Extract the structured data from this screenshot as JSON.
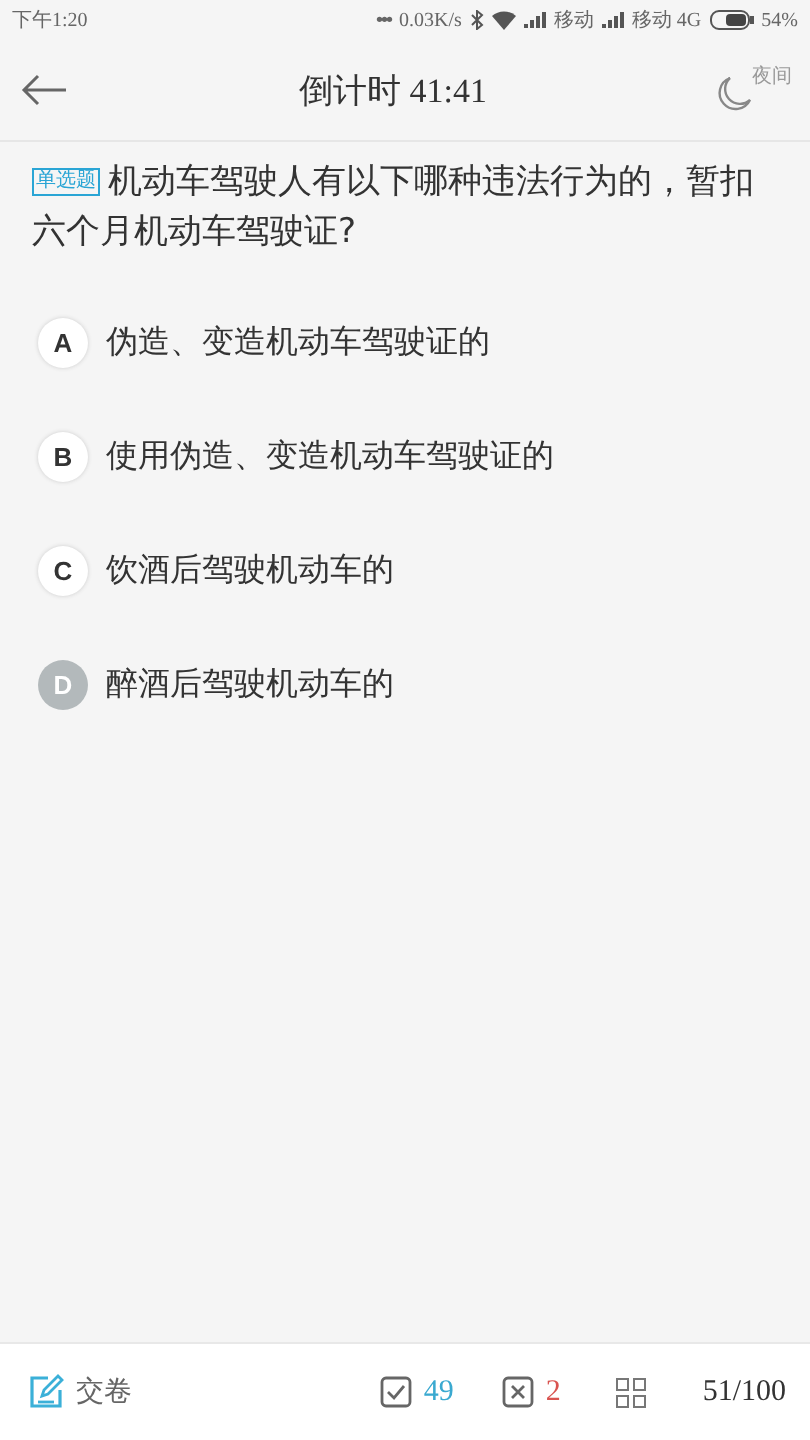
{
  "status_bar": {
    "time": "下午1:20",
    "dots": "•••",
    "speed": "0.03K/s",
    "carrier_1": "移动",
    "carrier_2": "移动 4G",
    "battery": "54%"
  },
  "header": {
    "title": "倒计时 41:41",
    "night_label": "夜间"
  },
  "question": {
    "type_tag": "单选题",
    "text": "机动车驾驶人有以下哪种违法行为的，暂扣六个月机动车驾驶证?"
  },
  "options": [
    {
      "letter": "A",
      "text": "伪造、变造机动车驾驶证的",
      "selected": false
    },
    {
      "letter": "B",
      "text": "使用伪造、变造机动车驾驶证的",
      "selected": false
    },
    {
      "letter": "C",
      "text": "饮酒后驾驶机动车的",
      "selected": false
    },
    {
      "letter": "D",
      "text": "醉酒后驾驶机动车的",
      "selected": true
    }
  ],
  "bottom_bar": {
    "submit": "交卷",
    "correct": "49",
    "wrong": "2",
    "progress": "51/100"
  }
}
